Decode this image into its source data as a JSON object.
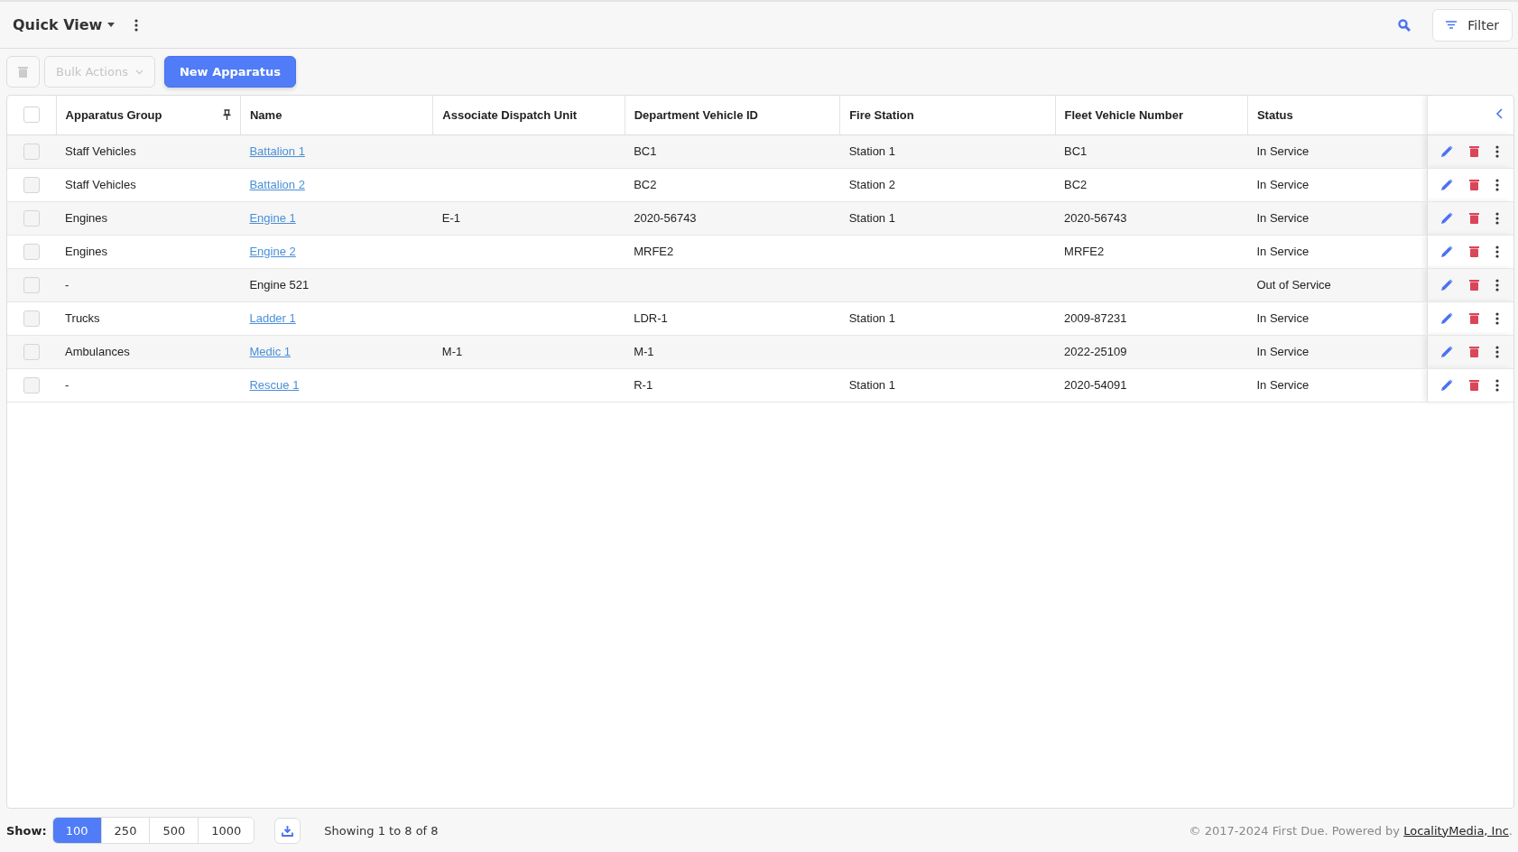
{
  "header": {
    "view_title": "Quick View",
    "filter_label": "Filter"
  },
  "toolbar": {
    "bulk_actions": "Bulk Actions",
    "new_button": "New Apparatus"
  },
  "table": {
    "select_all_checked": false,
    "columns": [
      "Apparatus Group",
      "Name",
      "Associate Dispatch Unit",
      "Department Vehicle ID",
      "Fire Station",
      "Fleet Vehicle Number",
      "Status"
    ],
    "rows": [
      {
        "selected": false,
        "group": "Staff Vehicles",
        "name": "Battalion 1",
        "name_linked": true,
        "dispatch_unit": "",
        "vehicle_id": "BC1",
        "station": "Station 1",
        "fleet_number": "BC1",
        "status": "In Service"
      },
      {
        "selected": false,
        "group": "Staff Vehicles",
        "name": "Battalion 2",
        "name_linked": true,
        "dispatch_unit": "",
        "vehicle_id": "BC2",
        "station": "Station 2",
        "fleet_number": "BC2",
        "status": "In Service"
      },
      {
        "selected": false,
        "group": "Engines",
        "name": "Engine 1",
        "name_linked": true,
        "dispatch_unit": "E-1",
        "vehicle_id": "2020-56743",
        "station": "Station 1",
        "fleet_number": "2020-56743",
        "status": "In Service"
      },
      {
        "selected": false,
        "group": "Engines",
        "name": "Engine 2",
        "name_linked": true,
        "dispatch_unit": "",
        "vehicle_id": "MRFE2",
        "station": "",
        "fleet_number": "MRFE2",
        "status": "In Service"
      },
      {
        "selected": false,
        "group": "-",
        "name": "Engine 521",
        "name_linked": false,
        "dispatch_unit": "",
        "vehicle_id": "",
        "station": "",
        "fleet_number": "",
        "status": "Out of Service"
      },
      {
        "selected": false,
        "group": "Trucks",
        "name": "Ladder 1",
        "name_linked": true,
        "dispatch_unit": "",
        "vehicle_id": "LDR-1",
        "station": "Station 1",
        "fleet_number": "2009-87231",
        "status": "In Service"
      },
      {
        "selected": false,
        "group": "Ambulances",
        "name": "Medic 1",
        "name_linked": true,
        "dispatch_unit": "M-1",
        "vehicle_id": "M-1",
        "station": "",
        "fleet_number": "2022-25109",
        "status": "In Service"
      },
      {
        "selected": false,
        "group": "-",
        "name": "Rescue 1",
        "name_linked": true,
        "dispatch_unit": "",
        "vehicle_id": "R-1",
        "station": "Station 1",
        "fleet_number": "2020-54091",
        "status": "In Service"
      }
    ]
  },
  "footer": {
    "show_label": "Show:",
    "page_sizes": [
      {
        "label": "100",
        "selected": true
      },
      {
        "label": "250",
        "selected": false
      },
      {
        "label": "500",
        "selected": false
      },
      {
        "label": "1000",
        "selected": false
      }
    ],
    "showing": "Showing 1 to 8 of 8",
    "copyright": "© 2017-2024 First Due. Powered by",
    "company_link": "LocalityMedia, Inc",
    "period": "."
  }
}
